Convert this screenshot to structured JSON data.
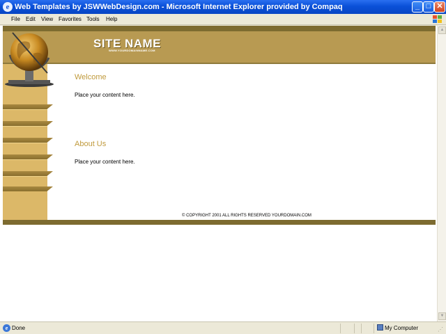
{
  "window": {
    "title": "Web Templates by JSWWebDesign.com - Microsoft Internet Explorer provided by Compaq",
    "app_icon_glyph": "e",
    "minimize_glyph": "_",
    "maximize_glyph": "□",
    "close_glyph": "✕"
  },
  "menu": {
    "items": [
      "File",
      "Edit",
      "View",
      "Favorites",
      "Tools",
      "Help"
    ]
  },
  "page": {
    "site_name": "SITE NAME",
    "site_url": "WWW.YOURDOMAINNAME.COM",
    "sections": [
      {
        "heading": "Welcome",
        "text": "Place your content here."
      },
      {
        "heading": "About Us",
        "text": "Place your content here."
      }
    ],
    "copyright": "© COPYRIGHT 2001 ALL RIGHTS RESERVED YOURDOMAIN.COM"
  },
  "colors": {
    "header_tan": "#b89a52",
    "dark_stripe": "#7d6b30",
    "sidebar_gold": "#dcb868",
    "heading_gold": "#c09a3c"
  },
  "statusbar": {
    "status_text": "Done",
    "zone_text": "My Computer",
    "status_icon": "ie-page-icon",
    "zone_icon": "computer-icon"
  }
}
